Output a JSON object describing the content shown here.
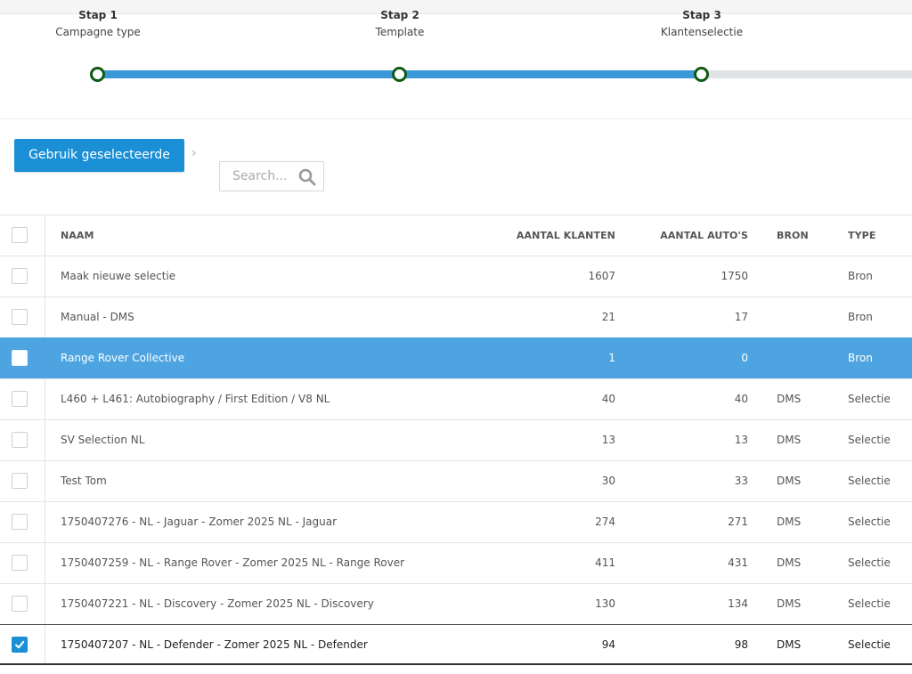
{
  "stepper": {
    "steps": [
      {
        "title": "Stap 1",
        "subtitle": "Campagne type"
      },
      {
        "title": "Stap 2",
        "subtitle": "Template"
      },
      {
        "title": "Stap 3",
        "subtitle": "Klantenselectie"
      }
    ],
    "colors": {
      "progress": "#3a97d8",
      "track": "#dfe3e5",
      "dot_border": "#0f5a12"
    }
  },
  "toolbar": {
    "use_selected_label": "Gebruik geselecteerde",
    "chevron": "›",
    "search_placeholder": "Search...",
    "search_icon": "search-icon"
  },
  "table": {
    "headers": {
      "naam": "NAAM",
      "aantal_klanten": "AANTAL KLANTEN",
      "aantal_autos": "AANTAL AUTO'S",
      "bron": "BRON",
      "type": "TYPE"
    },
    "rows": [
      {
        "naam": "Maak nieuwe selectie",
        "klanten": "1607",
        "autos": "1750",
        "bron": "",
        "type": "Bron",
        "checked": false,
        "highlighted": false
      },
      {
        "naam": "Manual - DMS",
        "klanten": "21",
        "autos": "17",
        "bron": "",
        "type": "Bron",
        "checked": false,
        "highlighted": false
      },
      {
        "naam": "Range Rover Collective",
        "klanten": "1",
        "autos": "0",
        "bron": "",
        "type": "Bron",
        "checked": false,
        "highlighted": true
      },
      {
        "naam": "L460 + L461: Autobiography / First Edition / V8 NL",
        "klanten": "40",
        "autos": "40",
        "bron": "DMS",
        "type": "Selectie",
        "checked": false,
        "highlighted": false
      },
      {
        "naam": "SV Selection NL",
        "klanten": "13",
        "autos": "13",
        "bron": "DMS",
        "type": "Selectie",
        "checked": false,
        "highlighted": false
      },
      {
        "naam": "Test Tom",
        "klanten": "30",
        "autos": "33",
        "bron": "DMS",
        "type": "Selectie",
        "checked": false,
        "highlighted": false
      },
      {
        "naam": "1750407276 - NL - Jaguar - Zomer 2025 NL - Jaguar",
        "klanten": "274",
        "autos": "271",
        "bron": "DMS",
        "type": "Selectie",
        "checked": false,
        "highlighted": false
      },
      {
        "naam": "1750407259 - NL - Range Rover - Zomer 2025 NL - Range Rover",
        "klanten": "411",
        "autos": "431",
        "bron": "DMS",
        "type": "Selectie",
        "checked": false,
        "highlighted": false
      },
      {
        "naam": "1750407221 - NL - Discovery - Zomer 2025 NL - Discovery",
        "klanten": "130",
        "autos": "134",
        "bron": "DMS",
        "type": "Selectie",
        "checked": false,
        "highlighted": false
      },
      {
        "naam": "1750407207 - NL - Defender - Zomer 2025 NL - Defender",
        "klanten": "94",
        "autos": "98",
        "bron": "DMS",
        "type": "Selectie",
        "checked": true,
        "highlighted": false
      }
    ],
    "colors": {
      "highlight": "#4ea4e0",
      "check": "#1a8fd6"
    }
  }
}
